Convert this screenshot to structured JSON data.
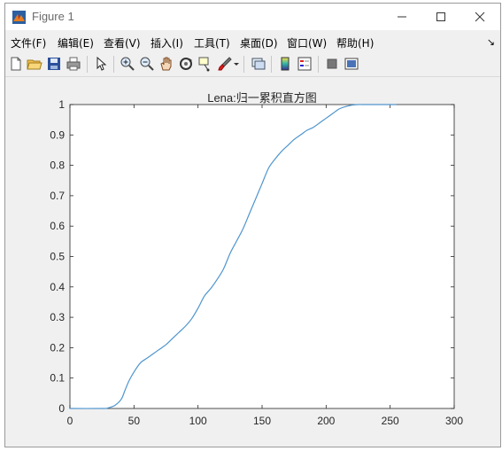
{
  "window": {
    "title": "Figure 1"
  },
  "menu": {
    "items": [
      "文件(F)",
      "编辑(E)",
      "查看(V)",
      "插入(I)",
      "工具(T)",
      "桌面(D)",
      "窗口(W)",
      "帮助(H)"
    ]
  },
  "toolbar": {
    "icons": [
      "new-figure-icon",
      "open-file-icon",
      "save-icon",
      "print-icon",
      "pointer-icon",
      "zoom-in-icon",
      "zoom-out-icon",
      "pan-icon",
      "rotate-3d-icon",
      "data-cursor-icon",
      "brush-icon",
      "brush-dropdown-icon",
      "link-plot-icon",
      "colorbar-icon",
      "legend-icon",
      "hide-plot-tools-icon",
      "show-plot-tools-icon"
    ]
  },
  "chart_data": {
    "type": "line",
    "title": "Lena:归一累积直方图",
    "xlabel": "",
    "ylabel": "",
    "xlim": [
      0,
      300
    ],
    "ylim": [
      0,
      1
    ],
    "xticks": [
      "0",
      "50",
      "100",
      "150",
      "200",
      "250",
      "300"
    ],
    "yticks": [
      "0",
      "0.1",
      "0.2",
      "0.3",
      "0.4",
      "0.5",
      "0.6",
      "0.7",
      "0.8",
      "0.9",
      "1"
    ],
    "grid": false,
    "line_color": "#4f95cd",
    "series": [
      {
        "x": [
          0,
          25,
          30,
          35,
          40,
          43,
          46,
          50,
          55,
          60,
          65,
          70,
          75,
          80,
          85,
          90,
          95,
          100,
          105,
          110,
          115,
          120,
          125,
          130,
          135,
          140,
          145,
          150,
          155,
          160,
          165,
          170,
          175,
          180,
          185,
          190,
          195,
          200,
          205,
          210,
          215,
          220,
          225,
          230,
          240,
          255
        ],
        "y": [
          0,
          0,
          0.002,
          0.01,
          0.03,
          0.06,
          0.09,
          0.12,
          0.15,
          0.165,
          0.18,
          0.195,
          0.21,
          0.23,
          0.25,
          0.27,
          0.295,
          0.33,
          0.37,
          0.395,
          0.425,
          0.46,
          0.51,
          0.55,
          0.59,
          0.64,
          0.69,
          0.74,
          0.79,
          0.82,
          0.845,
          0.865,
          0.885,
          0.9,
          0.915,
          0.925,
          0.94,
          0.955,
          0.97,
          0.985,
          0.993,
          0.998,
          1.0,
          1.0,
          1.0,
          1.0
        ]
      }
    ]
  }
}
